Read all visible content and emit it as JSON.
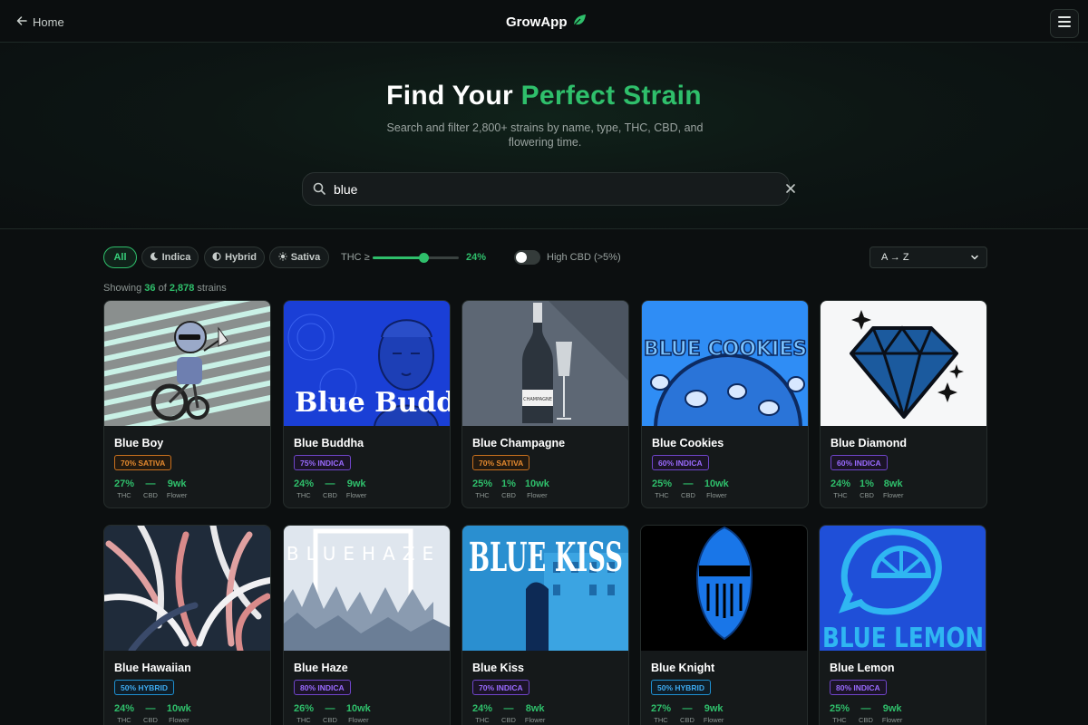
{
  "nav": {
    "back_label": "Home",
    "brand": "GrowApp"
  },
  "hero": {
    "title_part1": "Find Your ",
    "title_part2": "Perfect Strain",
    "subtitle": "Search and filter 2,800+ strains by name, type, THC, CBD, and flowering time."
  },
  "search": {
    "value": "blue",
    "placeholder": ""
  },
  "filters": {
    "type_pills": [
      {
        "label": "All",
        "active": true,
        "icon": ""
      },
      {
        "label": "Indica",
        "active": false,
        "icon": "moon-icon"
      },
      {
        "label": "Hybrid",
        "active": false,
        "icon": "half-circle-icon"
      },
      {
        "label": "Sativa",
        "active": false,
        "icon": "sun-icon"
      }
    ],
    "thc_label": "THC ≥",
    "thc_value": "24%",
    "thc_slider_fraction": 0.59,
    "high_cbd_label": "High CBD (>5%)",
    "high_cbd_enabled": false,
    "sort_value": "A → Z"
  },
  "results": {
    "prefix": "Showing ",
    "shown": "36",
    "middle": " of ",
    "total": "2,878",
    "suffix": " strains"
  },
  "stat_labels": {
    "thc": "THC",
    "cbd": "CBD",
    "flower": "Flower"
  },
  "strains": [
    {
      "name": "Blue Boy",
      "badge": "70% SATIVA",
      "type": "sativa",
      "thc": "27%",
      "cbd": "—",
      "flower": "9wk"
    },
    {
      "name": "Blue Buddha",
      "badge": "75% INDICA",
      "type": "indica",
      "thc": "24%",
      "cbd": "—",
      "flower": "9wk",
      "art_text": "Blue Buddha"
    },
    {
      "name": "Blue Champagne",
      "badge": "70% SATIVA",
      "type": "sativa",
      "thc": "25%",
      "cbd": "1%",
      "flower": "10wk",
      "art_text": "CHAMPAGNE"
    },
    {
      "name": "Blue Cookies",
      "badge": "60% INDICA",
      "type": "indica",
      "thc": "25%",
      "cbd": "—",
      "flower": "10wk",
      "art_text": "BLUE COOKIES"
    },
    {
      "name": "Blue Diamond",
      "badge": "60% INDICA",
      "type": "indica",
      "thc": "24%",
      "cbd": "1%",
      "flower": "8wk"
    },
    {
      "name": "Blue Hawaiian",
      "badge": "50% HYBRID",
      "type": "hybrid",
      "thc": "24%",
      "cbd": "—",
      "flower": "10wk"
    },
    {
      "name": "Blue Haze",
      "badge": "80% INDICA",
      "type": "indica",
      "thc": "26%",
      "cbd": "—",
      "flower": "10wk",
      "art_text": "BLUEHAZE"
    },
    {
      "name": "Blue Kiss",
      "badge": "70% INDICA",
      "type": "indica",
      "thc": "24%",
      "cbd": "—",
      "flower": "8wk",
      "art_text": "BLUE KISS"
    },
    {
      "name": "Blue Knight",
      "badge": "50% HYBRID",
      "type": "hybrid",
      "thc": "27%",
      "cbd": "—",
      "flower": "9wk"
    },
    {
      "name": "Blue Lemon",
      "badge": "80% INDICA",
      "type": "indica",
      "thc": "25%",
      "cbd": "—",
      "flower": "9wk",
      "art_text": "BLUE LEMON"
    }
  ],
  "colors": {
    "accent": "#2fbf6b",
    "background": "#0c0f10",
    "sativa": "#e58a2f",
    "indica": "#9a6bff",
    "hybrid": "#3eaaf0"
  }
}
